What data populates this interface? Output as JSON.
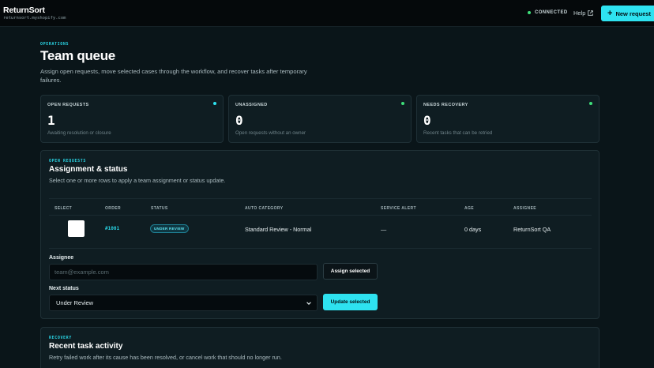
{
  "app": {
    "name": "ReturnSort",
    "domain": "returnsort.myshopify.com"
  },
  "header": {
    "connection_status": "CONNECTED",
    "help_label": "Help",
    "new_request_label": "New request"
  },
  "page": {
    "eyebrow": "OPERATIONS",
    "title": "Team queue",
    "subtitle": "Assign open requests, move selected cases through the workflow, and recover tasks after temporary failures."
  },
  "stats": [
    {
      "label": "OPEN REQUESTS",
      "value": "1",
      "note": "Awaiting resolution or closure",
      "dot_color": "#2ee2f0"
    },
    {
      "label": "UNASSIGNED",
      "value": "0",
      "note": "Open requests without an owner",
      "dot_color": "#3ee07a"
    },
    {
      "label": "NEEDS RECOVERY",
      "value": "0",
      "note": "Recent tasks that can be retried",
      "dot_color": "#3ee07a"
    }
  ],
  "assignment": {
    "eyebrow": "OPEN REQUESTS",
    "title": "Assignment & status",
    "subtitle": "Select one or more rows to apply a team assignment or status update.",
    "columns": [
      "SELECT",
      "ORDER",
      "STATUS",
      "AUTO CATEGORY",
      "SERVICE ALERT",
      "AGE",
      "ASSIGNEE"
    ],
    "rows": [
      {
        "selected": false,
        "order": "#1001",
        "status": "UNDER REVIEW",
        "category": "Standard Review - Normal",
        "alert": "—",
        "age": "0 days",
        "assignee": "ReturnSort QA"
      }
    ],
    "assignee_label": "Assignee",
    "assignee_value": "",
    "assignee_placeholder": "team@example.com",
    "assign_button": "Assign selected",
    "next_status_label": "Next status",
    "next_status_value": "Under Review",
    "update_button": "Update selected"
  },
  "recovery": {
    "eyebrow": "RECOVERY",
    "title": "Recent task activity",
    "subtitle": "Retry failed work after its cause has been resolved, or cancel work that should no longer run."
  }
}
